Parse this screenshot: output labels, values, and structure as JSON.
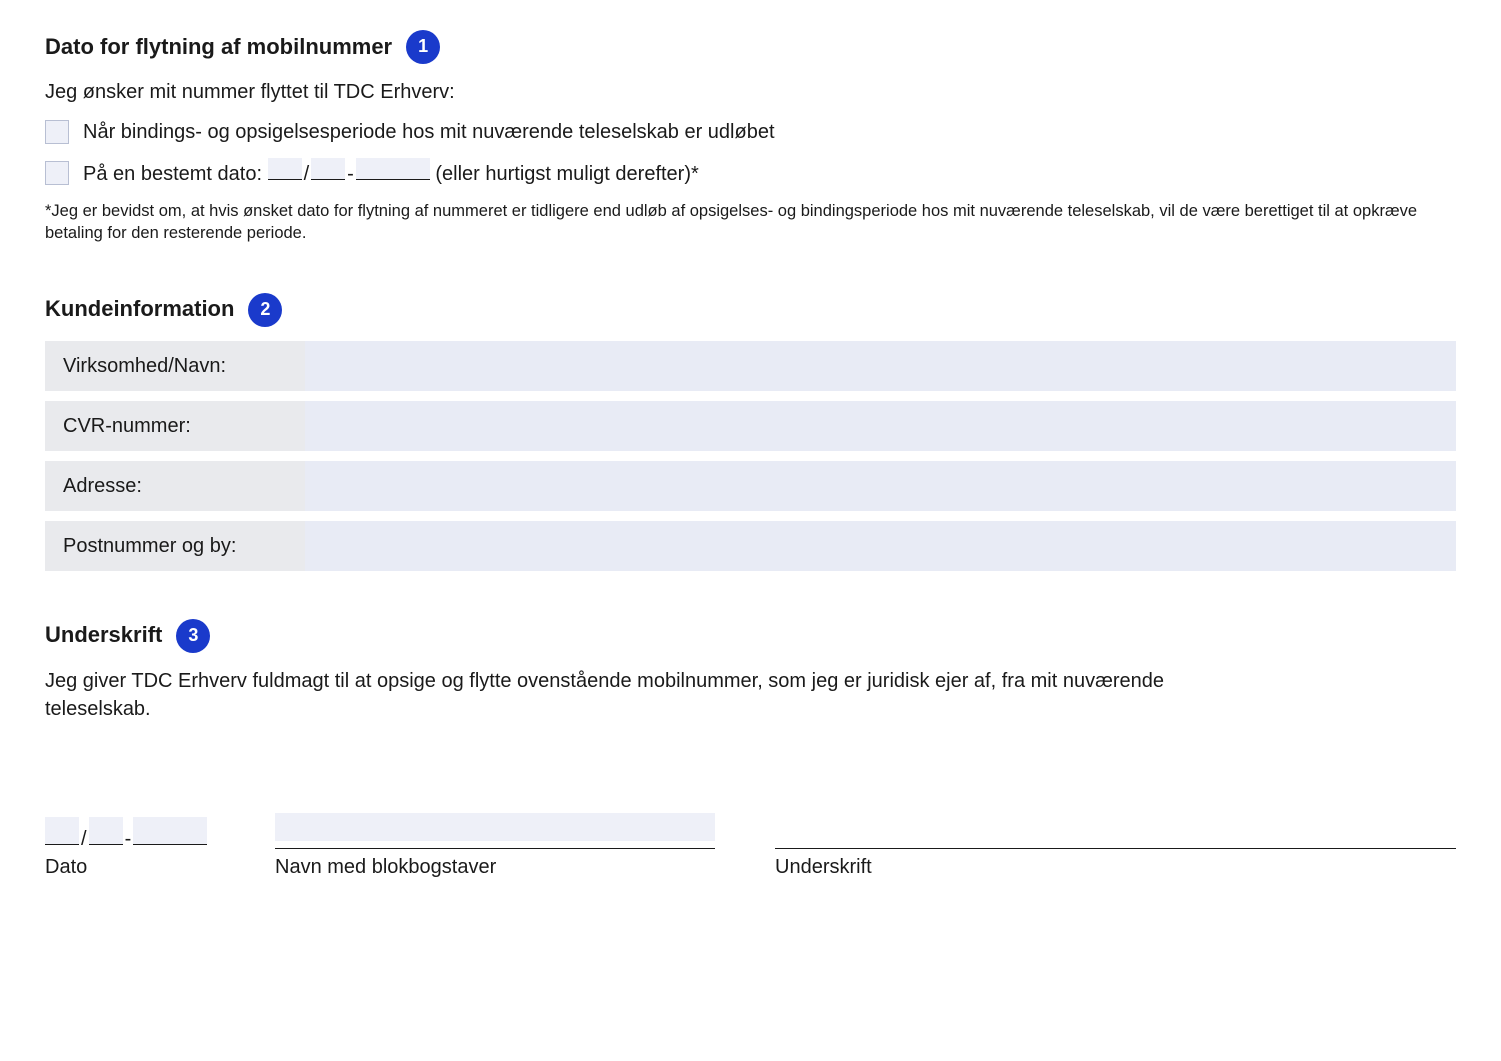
{
  "section1": {
    "title": "Dato for flytning af mobilnummer",
    "badge": "1",
    "intro": "Jeg ønsker mit nummer flyttet til TDC Erhverv:",
    "opt_expiry": "Når bindings- og opsigelsesperiode hos mit nuværende teleselskab er udløbet",
    "opt_date_prefix": "På en bestemt dato: ",
    "slash": "/",
    "dash": "-",
    "opt_date_suffix": " (eller hurtigst muligt derefter)*",
    "footnote": "*Jeg er bevidst om, at hvis ønsket dato for flytning af nummeret er tidligere end udløb af opsigelses- og bindingsperiode hos mit nuværende teleselskab, vil de være berettiget til at opkræve betaling for den resterende periode."
  },
  "section2": {
    "title": "Kundeinformation",
    "badge": "2",
    "fields": {
      "company": "Virksomhed/Navn:",
      "cvr": "CVR-nummer:",
      "address": "Adresse:",
      "postal": "Postnummer og by:"
    }
  },
  "section3": {
    "title": "Underskrift",
    "badge": "3",
    "text": "Jeg giver TDC Erhverv fuldmagt til at opsige og flytte ovenstående mobilnummer, som jeg er juridisk ejer af, fra mit nuværende teleselskab.",
    "slash": "/",
    "dash": "-",
    "caption_date": "Dato",
    "caption_name": "Navn med blokbogstaver",
    "caption_sign": "Underskrift"
  }
}
